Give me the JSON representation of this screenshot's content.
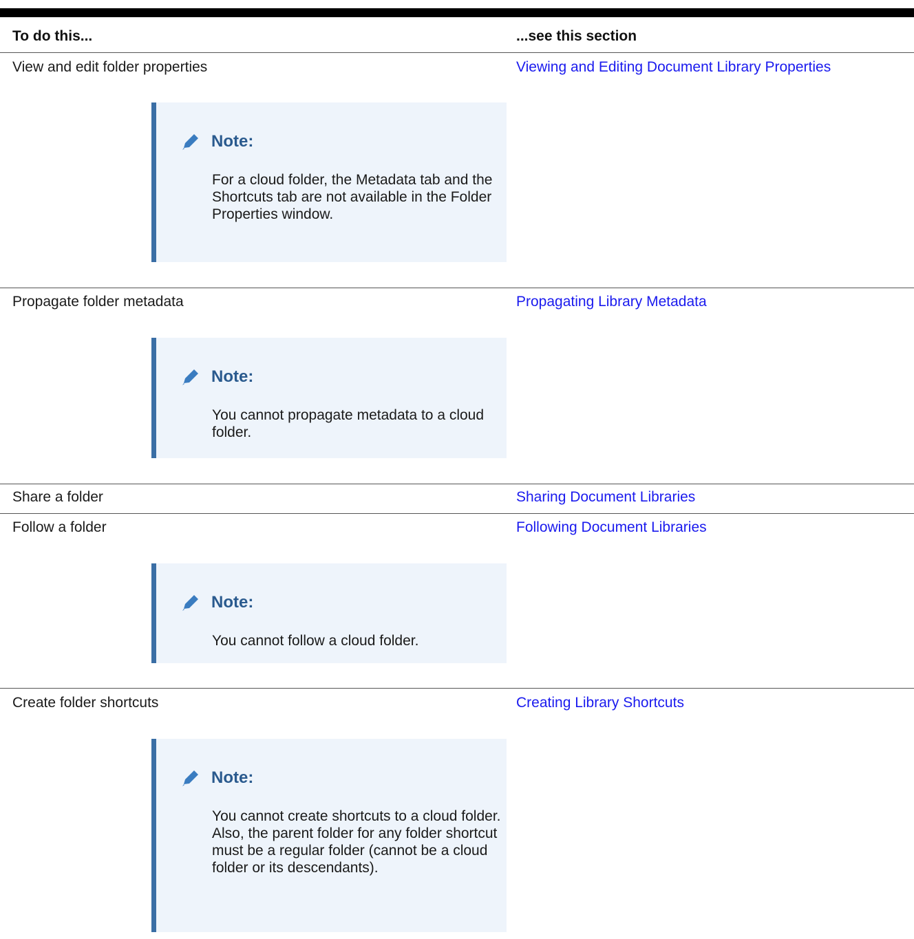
{
  "table": {
    "header": {
      "col1": "To do this...",
      "col2": "...see this section"
    },
    "rows": [
      {
        "task": "View and edit folder properties",
        "link": "Viewing and Editing Document Library Properties",
        "note": {
          "title": "Note:",
          "text": "For a cloud folder, the Metadata tab and the Shortcuts tab are not available in the Folder Properties window."
        }
      },
      {
        "task": "Propagate folder metadata",
        "link": "Propagating Library Metadata",
        "note": {
          "title": "Note:",
          "text": "You cannot propagate metadata to a cloud folder."
        }
      },
      {
        "task": "Share a folder",
        "link": "Sharing Document Libraries"
      },
      {
        "task": "Follow a folder",
        "link": "Following Document Libraries",
        "note": {
          "title": "Note:",
          "text": "You cannot follow a cloud folder."
        }
      },
      {
        "task": "Create folder shortcuts",
        "link": "Creating Library Shortcuts",
        "note": {
          "title": "Note:",
          "text": "You cannot create shortcuts to a cloud folder. Also, the parent folder for any folder shortcut must be a regular folder (cannot be a cloud folder or its descendants)."
        }
      }
    ]
  },
  "icons": {
    "note_icon": "pencil-icon"
  },
  "colors": {
    "link": "#1a1aee",
    "note_background": "#eef4fb",
    "note_border": "#3a6ea5",
    "note_title": "#2a5a8e"
  }
}
